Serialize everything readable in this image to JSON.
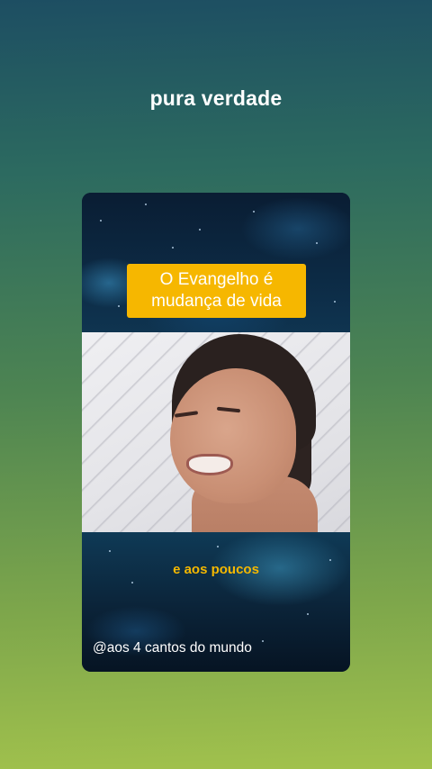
{
  "post": {
    "caption": "pura verdade"
  },
  "video": {
    "title_line1": "O Evangelho é",
    "title_line2": "mudança de vida",
    "subtitle": "e aos poucos",
    "watermark": "@aos 4 cantos do mundo"
  },
  "colors": {
    "background_top": "#1d4e62",
    "background_bottom": "#a2c24d",
    "title_box": "#f6b700",
    "subtitle_text": "#f5b800",
    "text": "#ffffff"
  }
}
